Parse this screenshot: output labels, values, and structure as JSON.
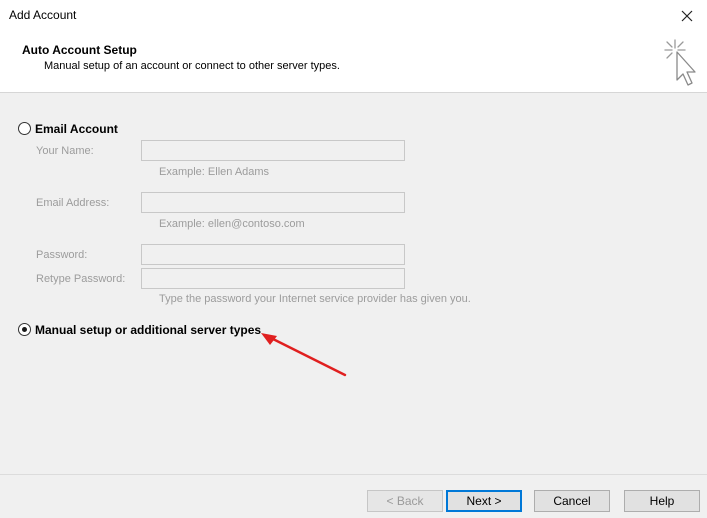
{
  "window": {
    "title": "Add Account",
    "close_icon": "close-icon"
  },
  "header": {
    "title": "Auto Account Setup",
    "subtitle": "Manual setup of an account or connect to other server types.",
    "icon": "wizard-sparkle-cursor-icon"
  },
  "email_account": {
    "label": "Email Account",
    "selected": false,
    "your_name": {
      "label": "Your Name:",
      "value": "",
      "hint": "Example: Ellen Adams"
    },
    "email_address": {
      "label": "Email Address:",
      "value": "",
      "hint": "Example: ellen@contoso.com"
    },
    "password": {
      "label": "Password:",
      "value": ""
    },
    "retype_password": {
      "label": "Retype Password:",
      "value": ""
    },
    "password_hint": "Type the password your Internet service provider has given you."
  },
  "manual_setup": {
    "label": "Manual setup or additional server types",
    "selected": true
  },
  "annotation": {
    "icon": "red-arrow-icon",
    "color": "#e02020"
  },
  "buttons": {
    "back": "< Back",
    "next": "Next >",
    "cancel": "Cancel",
    "help": "Help"
  },
  "colors": {
    "accent": "#0078d7",
    "disabled_text": "#9c9c9c"
  }
}
